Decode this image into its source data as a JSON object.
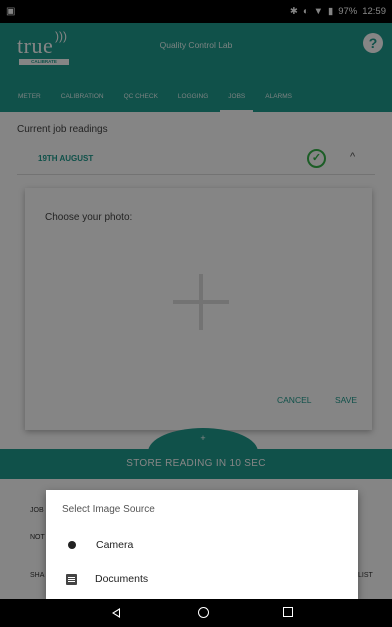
{
  "status_bar": {
    "battery": "97%",
    "time": "12:59"
  },
  "app_bar": {
    "logo_text": "true",
    "logo_tag": "CALIBRATE",
    "title": "Quality Control Lab",
    "help_glyph": "?"
  },
  "tabs": [
    {
      "label": "METER"
    },
    {
      "label": "CALIBRATION"
    },
    {
      "label": "QC CHECK"
    },
    {
      "label": "LOGGING"
    },
    {
      "label": "JOBS"
    },
    {
      "label": "ALARMS"
    }
  ],
  "active_tab": "JOBS",
  "current_job": {
    "section_label": "Current job readings",
    "date": "19TH AUGUST"
  },
  "photo_card": {
    "prompt": "Choose your photo:",
    "cancel_label": "CANCEL",
    "save_label": "SAVE"
  },
  "fab_label": "+",
  "store_bar": {
    "label": "STORE READING IN 10 SEC"
  },
  "background_fragments": {
    "job": "JOB",
    "not": "NOT",
    "sha": "SHA",
    "list": "LIST"
  },
  "dialog": {
    "title": "Select Image Source",
    "options": [
      {
        "label": "Camera",
        "icon": "camera-icon"
      },
      {
        "label": "Documents",
        "icon": "documents-icon"
      }
    ]
  },
  "nav_bar": {
    "back_icon": "back-icon",
    "home_icon": "home-icon",
    "recents_icon": "recents-icon"
  },
  "colors": {
    "accent": "#1f9b8e",
    "success": "#36b34a",
    "scrim": "rgba(0,0,0,0.48)"
  }
}
